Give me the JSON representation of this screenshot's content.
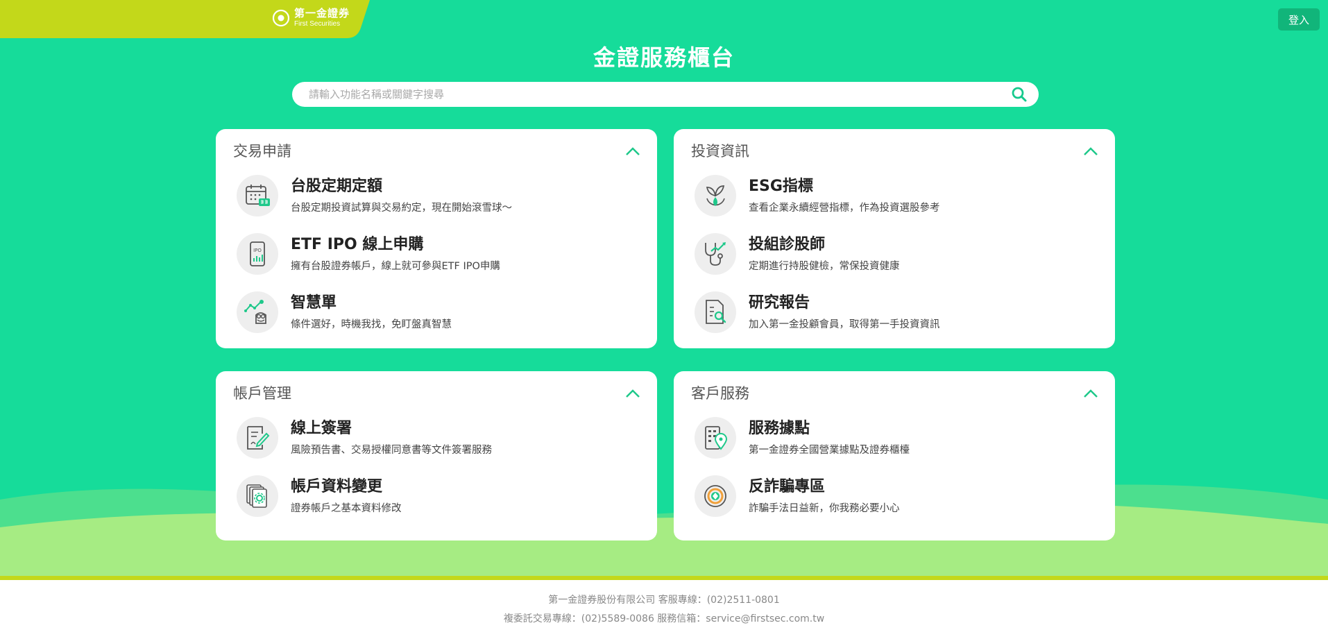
{
  "header": {
    "logo_zh": "第一金證券",
    "logo_en": "First Securities",
    "login_label": "登入"
  },
  "page_title": "金證服務櫃台",
  "search": {
    "placeholder": "請輸入功能名稱或關鍵字搜尋",
    "value": ""
  },
  "sections": [
    {
      "title": "交易申請",
      "items": [
        {
          "title": "台股定期定額",
          "desc": "台股定期投資試算與交易約定，現在開始滾雪球～",
          "icon": "calendar-icon"
        },
        {
          "title": "ETF IPO 線上申購",
          "desc": "擁有台股證券帳戶，線上就可參與ETF IPO申購",
          "icon": "ipo-phone-icon"
        },
        {
          "title": "智慧單",
          "desc": "條件選好，時機我找，免盯盤真智慧",
          "icon": "owl-chart-icon"
        }
      ]
    },
    {
      "title": "投資資訊",
      "items": [
        {
          "title": "ESG指標",
          "desc": "查看企業永續經營指標，作為投資選股參考",
          "icon": "esg-leaf-icon"
        },
        {
          "title": "投組診股師",
          "desc": "定期進行持股健檢，常保投資健康",
          "icon": "stethoscope-icon"
        },
        {
          "title": "研究報告",
          "desc": "加入第一金投顧會員，取得第一手投資資訊",
          "icon": "report-search-icon"
        }
      ]
    },
    {
      "title": "帳戶管理",
      "items": [
        {
          "title": "線上簽署",
          "desc": "風險預告書、交易授權同意書等文件簽署服務",
          "icon": "sign-document-icon"
        },
        {
          "title": "帳戶資料變更",
          "desc": "證券帳戶之基本資料修改",
          "icon": "account-settings-icon"
        }
      ]
    },
    {
      "title": "客戶服務",
      "items": [
        {
          "title": "服務據點",
          "desc": "第一金證券全國營業據點及證券櫃檯",
          "icon": "location-building-icon"
        },
        {
          "title": "反詐騙專區",
          "desc": "詐騙手法日益新，你我務必要小心",
          "icon": "anti-fraud-icon"
        }
      ]
    }
  ],
  "footer": {
    "line1": "第一金證券股份有限公司  客服專線：(02)2511-0801",
    "line2": "複委託交易專線：(02)5589-0086   服務信箱：service@firstsec.com.tw"
  },
  "colors": {
    "brand_green": "#16dc9a",
    "accent_lime": "#c3d81a",
    "button_green": "#11b57a",
    "icon_green": "#1ec88a"
  }
}
